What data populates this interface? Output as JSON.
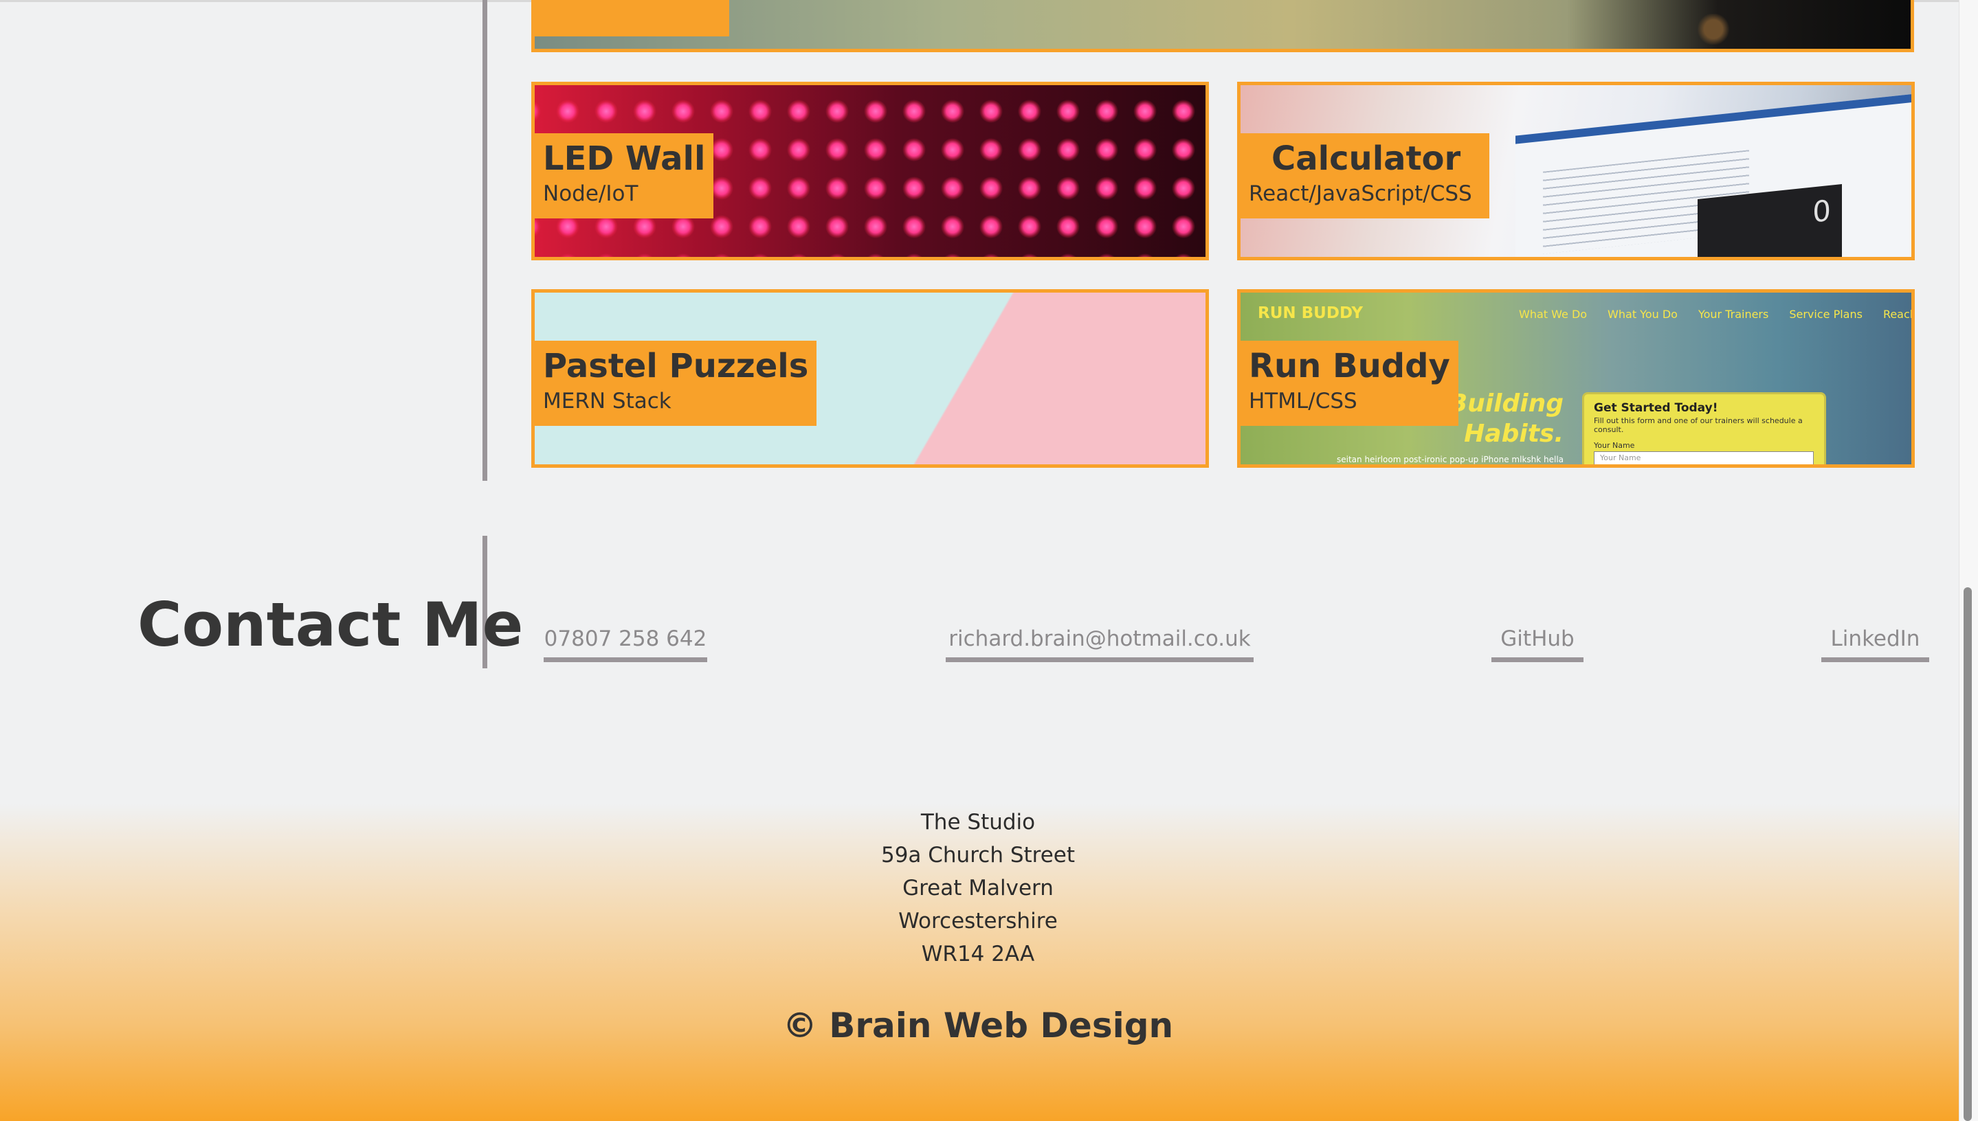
{
  "projects": [
    {
      "title": "LED Wall",
      "subtitle": "Node/IoT"
    },
    {
      "title": "Calculator",
      "subtitle": "React/JavaScript/CSS"
    },
    {
      "title": "Pastel Puzzels",
      "subtitle": "MERN Stack"
    },
    {
      "title": "Run Buddy",
      "subtitle": "HTML/CSS"
    }
  ],
  "calculator_preview": {
    "display": "0"
  },
  "run_buddy_preview": {
    "brand": "RUN BUDDY",
    "nav": [
      "What We Do",
      "What You Do",
      "Your Trainers",
      "Service Plans",
      "Reach Out"
    ],
    "headline": "rt Building Habits.",
    "tagline": "seitan heirloom post-ironic pop-up iPhone mlkshk hella",
    "form_title": "Get Started Today!",
    "form_desc": "Fill out this form and one of our trainers will schedule a consult.",
    "form_label": "Your Name",
    "form_placeholder": "Your Name"
  },
  "contact": {
    "title": "Contact Me",
    "phone": "07807 258 642",
    "email": "richard.brain@hotmail.co.uk",
    "github": "GitHub",
    "linkedin": "LinkedIn"
  },
  "footer": {
    "address": [
      "The Studio",
      "59a Church Street",
      "Great Malvern",
      "Worcestershire",
      "WR14 2AA"
    ],
    "copyright": "© Brain Web Design"
  },
  "colors": {
    "accent": "#f8a12a",
    "text": "#373737",
    "link": "#8c8a8c",
    "divider": "#9a9599",
    "background": "#f0f1f2"
  }
}
